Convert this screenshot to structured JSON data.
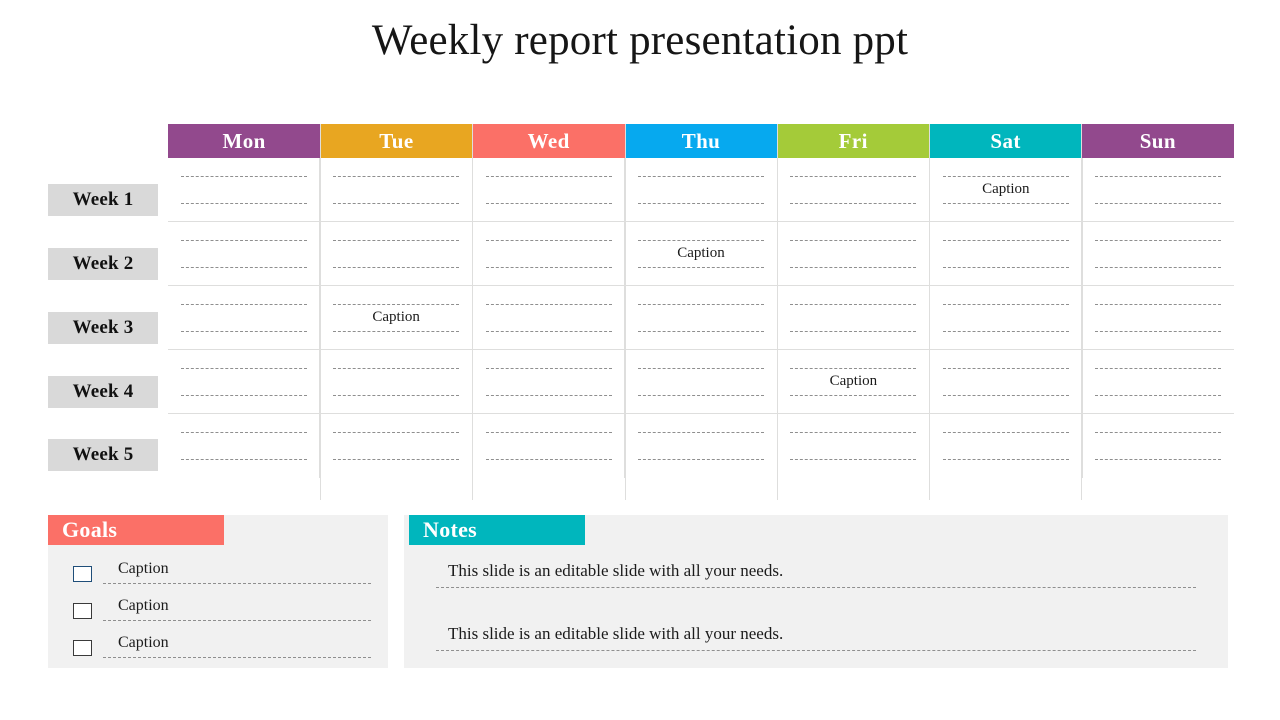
{
  "slide": {
    "title": "Weekly report presentation ppt",
    "background": "#ffffff"
  },
  "calendar": {
    "days": [
      {
        "label": "Mon",
        "color": "#92498d"
      },
      {
        "label": "Tue",
        "color": "#e8a621"
      },
      {
        "label": "Wed",
        "color": "#fb7067"
      },
      {
        "label": "Thu",
        "color": "#06a9ef"
      },
      {
        "label": "Fri",
        "color": "#a4cb39"
      },
      {
        "label": "Sat",
        "color": "#00b6bd"
      },
      {
        "label": "Sun",
        "color": "#92498d"
      }
    ],
    "week_labels": [
      "Week 1",
      "Week 2",
      "Week 3",
      "Week 4",
      "Week 5"
    ],
    "week_label_bg": "#d9d9d9",
    "caption_text": "Caption",
    "grid_line_color": "#dededd",
    "dotted_line_color": "#8f8f8f",
    "rows": [
      {
        "week": "Week 1",
        "cells": [
          "",
          "",
          "",
          "",
          "",
          "Caption",
          ""
        ]
      },
      {
        "week": "Week 2",
        "cells": [
          "",
          "",
          "",
          "Caption",
          "",
          "",
          ""
        ]
      },
      {
        "week": "Week 3",
        "cells": [
          "",
          "Caption",
          "",
          "",
          "",
          "",
          ""
        ]
      },
      {
        "week": "Week 4",
        "cells": [
          "",
          "",
          "",
          "",
          "Caption",
          "",
          ""
        ]
      },
      {
        "week": "Week 5",
        "cells": [
          "",
          "",
          "",
          "",
          "",
          "",
          ""
        ]
      }
    ]
  },
  "goals": {
    "title": "Goals",
    "accent": "#fb7067",
    "panel_bg": "#f1f1f1",
    "items": [
      {
        "label": "Caption",
        "checked": false
      },
      {
        "label": "Caption",
        "checked": false
      },
      {
        "label": "Caption",
        "checked": false
      }
    ]
  },
  "notes": {
    "title": "Notes",
    "accent": "#00b6bd",
    "panel_bg": "#f1f1f1",
    "lines": [
      "This slide is an editable slide with all your needs.",
      "This slide is an editable slide with all your needs."
    ]
  }
}
